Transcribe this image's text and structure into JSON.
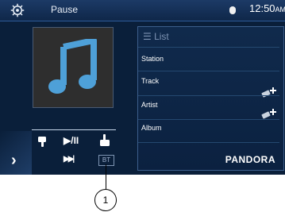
{
  "status_bar": {
    "title": "Pause",
    "time": "12:50",
    "ampm": "AM",
    "icons": [
      "gear-icon",
      "bluetooth-icon"
    ]
  },
  "controls": {
    "thumb_down_icon": "thumbs-down-icon",
    "play_pause_glyph": "▶/II",
    "thumb_up_icon": "thumbs-up-icon",
    "next_glyph": "▶▶|",
    "left_chevron": "›",
    "bt_badge": "BT"
  },
  "panel": {
    "header": "List",
    "fields": [
      {
        "label": "Station"
      },
      {
        "label": "Track"
      },
      {
        "label": "Artist"
      },
      {
        "label": "Album"
      }
    ],
    "brand": "PANDORA"
  },
  "callout": {
    "number": "1"
  },
  "colors": {
    "background": "#0a1f3a",
    "panel_border": "#3d5f8c",
    "text": "#ffffff"
  }
}
